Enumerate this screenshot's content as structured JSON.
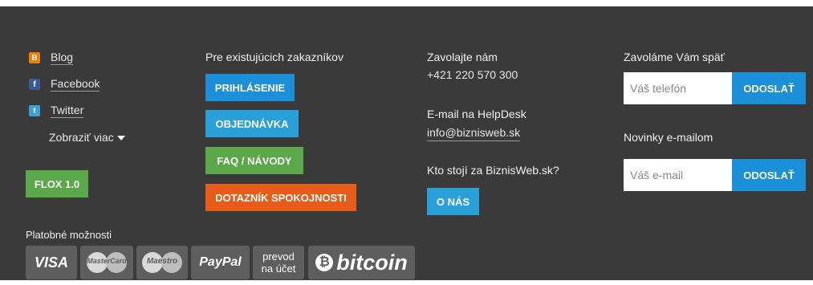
{
  "social": {
    "items": [
      {
        "label": "Blog",
        "icon": "blogger-icon",
        "icon_glyph": "B",
        "color": "#f57d00"
      },
      {
        "label": "Facebook",
        "icon": "facebook-icon",
        "icon_glyph": "f",
        "color": "#3b5998"
      },
      {
        "label": "Twitter",
        "icon": "twitter-icon",
        "icon_glyph": "t",
        "color": "#3aa0d9"
      }
    ],
    "show_more": "Zobraziť viac",
    "flox_label": "FLOX 1.0"
  },
  "customers": {
    "heading": "Pre existujúcich zakazníkov",
    "buttons": [
      {
        "label": "PRIHLÁSENIE",
        "color": "#1b8fd8"
      },
      {
        "label": "OBJEDNÁVKA",
        "color": "#2aa0d8"
      },
      {
        "label": "FAQ / NÁVODY",
        "color": "#5aa84a"
      },
      {
        "label": "DOTAZNÍK SPOKOJNOSTI",
        "color": "#e85c1a"
      }
    ]
  },
  "contact": {
    "call_heading": "Zavolajte nám",
    "phone": "+421 220 570 300",
    "email_heading": "E-mail na HelpDesk",
    "email": "info@biznisweb.sk",
    "about_heading": "Kto stojí za BiznisWeb.sk?",
    "about_button": "O NÁS",
    "about_color": "#2aa0d8"
  },
  "callback": {
    "heading": "Zavoláme Vám späť",
    "phone_placeholder": "Váš telefón",
    "submit_label": "ODOSLAŤ",
    "submit_color": "#1b8fd8"
  },
  "newsletter": {
    "heading": "Novinky e-mailom",
    "email_placeholder": "Váš e-mail",
    "submit_label": "ODOSLAŤ"
  },
  "payments": {
    "heading": "Platobné možnosti",
    "visa": "VISA",
    "mastercard": "MasterCard",
    "maestro": "Maestro",
    "paypal": "PayPal",
    "transfer_line1": "prevod",
    "transfer_line2": "na účet",
    "bitcoin": "bitcoin"
  },
  "colors": {
    "footer_bg": "#3a3a3a",
    "flox": "#5aa84a"
  }
}
